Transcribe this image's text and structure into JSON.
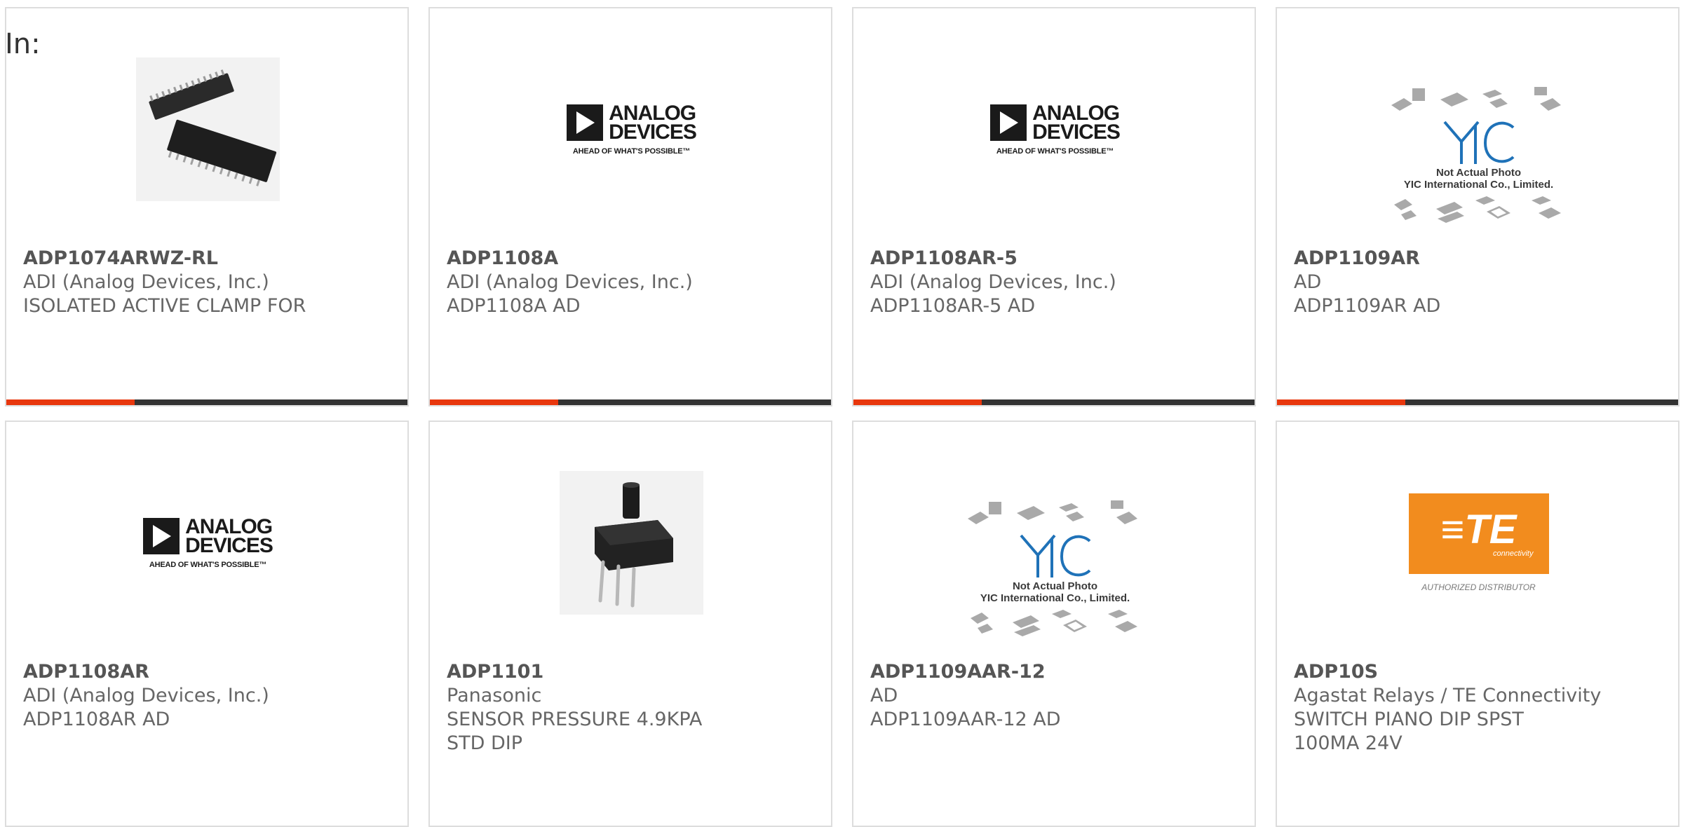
{
  "page": {
    "in_label": "In:"
  },
  "colors": {
    "accent_bar": "#e8370d",
    "dark_bar": "#333333",
    "card_border": "#dddddd",
    "text": "#666666"
  },
  "cards": [
    {
      "part_number": "ADP1074ARWZ-RL",
      "manufacturer": "ADI (Analog Devices, Inc.)",
      "description": "ISOLATED ACTIVE CLAMP FOR",
      "image": "ic-chip-soic-photo"
    },
    {
      "part_number": "ADP1108A",
      "manufacturer": "ADI (Analog Devices, Inc.)",
      "description": "ADP1108A AD",
      "image": "analog-devices-logo",
      "logo_text": [
        "ANALOG",
        "DEVICES"
      ],
      "logo_tagline": "AHEAD OF WHAT'S POSSIBLE™"
    },
    {
      "part_number": "ADP1108AR-5",
      "manufacturer": "ADI (Analog Devices, Inc.)",
      "description": "ADP1108AR-5 AD",
      "image": "analog-devices-logo",
      "logo_text": [
        "ANALOG",
        "DEVICES"
      ],
      "logo_tagline": "AHEAD OF WHAT'S POSSIBLE™"
    },
    {
      "part_number": "ADP1109AR",
      "manufacturer": "AD",
      "description": "ADP1109AR AD",
      "image": "yic-placeholder",
      "caption_line1": "Not Actual Photo",
      "caption_line2": "YIC International Co., Limited."
    },
    {
      "part_number": "ADP1108AR",
      "manufacturer": "ADI (Analog Devices, Inc.)",
      "description": "ADP1108AR AD",
      "image": "analog-devices-logo",
      "logo_text": [
        "ANALOG",
        "DEVICES"
      ],
      "logo_tagline": "AHEAD OF WHAT'S POSSIBLE™"
    },
    {
      "part_number": "ADP1101",
      "manufacturer": "Panasonic",
      "description": "SENSOR PRESSURE 4.9KPA STD DIP",
      "image": "pressure-sensor-photo"
    },
    {
      "part_number": "ADP1109AAR-12",
      "manufacturer": "AD",
      "description": "ADP1109AAR-12 AD",
      "image": "yic-placeholder",
      "caption_line1": "Not Actual Photo",
      "caption_line2": "YIC International Co., Limited."
    },
    {
      "part_number": "ADP10S",
      "manufacturer": "Agastat Relays / TE Connectivity",
      "description": "SWITCH PIANO DIP SPST 100MA 24V",
      "image": "te-connectivity-logo",
      "logo_text": [
        "≡TE",
        "connectivity"
      ],
      "logo_tagline": "AUTHORIZED DISTRIBUTOR"
    }
  ]
}
